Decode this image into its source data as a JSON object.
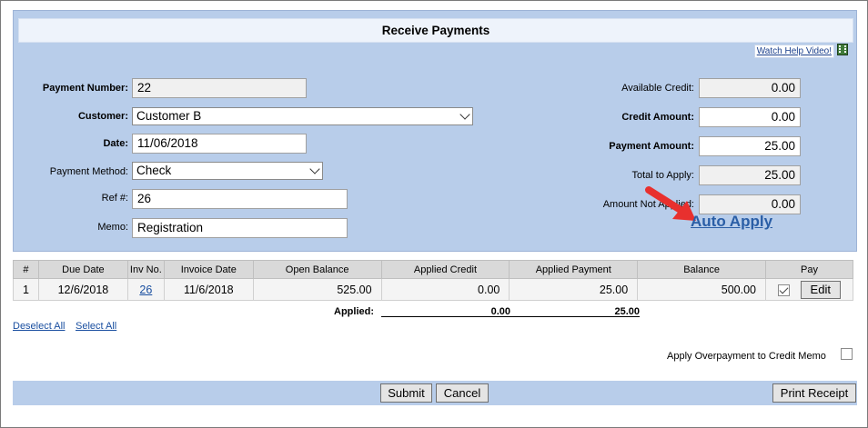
{
  "title": "Receive Payments",
  "help_link": "Watch Help Video!",
  "left_fields": {
    "payment_number_label": "Payment Number:",
    "payment_number": "22",
    "customer_label": "Customer:",
    "customer": "Customer B",
    "date_label": "Date:",
    "date": "11/06/2018",
    "payment_method_label": "Payment Method:",
    "payment_method": "Check",
    "ref_label": "Ref #:",
    "ref": "26",
    "memo_label": "Memo:",
    "memo": "Registration"
  },
  "right_fields": {
    "available_credit_label": "Available Credit:",
    "available_credit": "0.00",
    "credit_amount_label": "Credit Amount:",
    "credit_amount": "0.00",
    "payment_amount_label": "Payment Amount:",
    "payment_amount": "25.00",
    "total_to_apply_label": "Total to Apply:",
    "total_to_apply": "25.00",
    "amount_not_applied_label": "Amount Not Applied:",
    "amount_not_applied": "0.00"
  },
  "auto_apply": "Auto Apply",
  "table": {
    "headers": [
      "#",
      "Due Date",
      "Inv No.",
      "Invoice Date",
      "Open Balance",
      "Applied Credit",
      "Applied Payment",
      "Balance",
      "Pay"
    ],
    "rows": [
      {
        "num": "1",
        "due_date": "12/6/2018",
        "inv_no": "26",
        "invoice_date": "11/6/2018",
        "open_balance": "525.00",
        "applied_credit": "0.00",
        "applied_payment": "25.00",
        "balance": "500.00",
        "pay_checked": true,
        "edit_label": "Edit"
      }
    ]
  },
  "applied": {
    "label": "Applied:",
    "credit": "0.00",
    "payment": "25.00"
  },
  "deselect_all": "Deselect All",
  "select_all": "Select All",
  "overpayment_label": "Apply Overpayment to Credit Memo",
  "buttons": {
    "submit": "Submit",
    "cancel": "Cancel",
    "print_receipt": "Print Receipt"
  },
  "colors": {
    "panel_bg": "#b8cdea",
    "link": "#2a5ea6",
    "arrow": "#e8302e"
  }
}
